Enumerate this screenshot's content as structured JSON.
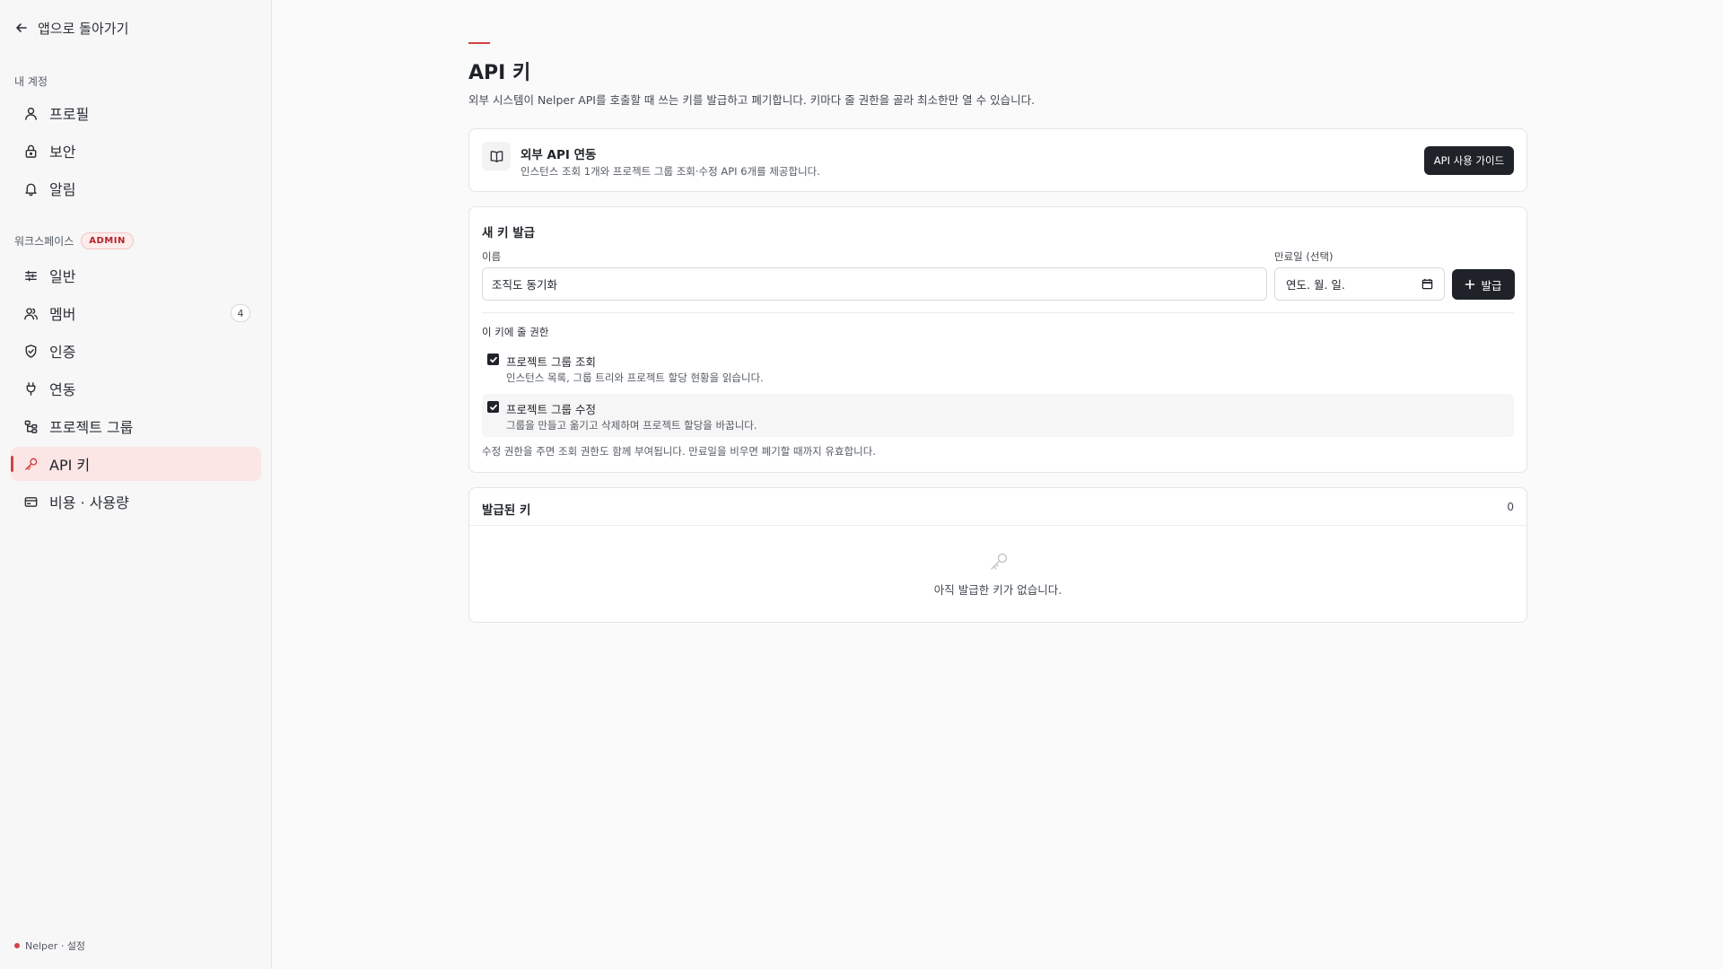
{
  "sidebar": {
    "back_label": "앱으로 돌아가기",
    "account_section_label": "내 계정",
    "account_items": [
      {
        "label": "프로필",
        "icon": "user-icon"
      },
      {
        "label": "보안",
        "icon": "lock-icon"
      },
      {
        "label": "알림",
        "icon": "bell-icon"
      }
    ],
    "workspace_section_label": "워크스페이스",
    "workspace_badge": "ADMIN",
    "workspace_items": [
      {
        "label": "일반",
        "icon": "sliders-icon"
      },
      {
        "label": "멤버",
        "icon": "users-icon",
        "count": "4"
      },
      {
        "label": "인증",
        "icon": "shield-icon"
      },
      {
        "label": "연동",
        "icon": "plug-icon"
      },
      {
        "label": "프로젝트 그룹",
        "icon": "tree-icon"
      },
      {
        "label": "API 키",
        "icon": "key-icon",
        "active": true
      },
      {
        "label": "비용 · 사용량",
        "icon": "card-icon"
      }
    ],
    "footer": "Nelper · 설정"
  },
  "page": {
    "title": "API 키",
    "description": "외부 시스템이 Nelper API를 호출할 때 쓰는 키를 발급하고 폐기합니다. 키마다 줄 권한을 골라 최소한만 열 수 있습니다."
  },
  "guide": {
    "title": "외부 API 연동",
    "description": "인스턴스 조회 1개와 프로젝트 그룹 조회·수정 API 6개를 제공합니다.",
    "button_label": "API 사용 가이드"
  },
  "new_key": {
    "title": "새 키 발급",
    "name_label": "이름",
    "name_value": "조직도 동기화",
    "expiry_label": "만료일 (선택)",
    "expiry_placeholder": "연도. 월. 일.",
    "issue_button": "발급",
    "permissions_label": "이 키에 줄 권한",
    "permissions": [
      {
        "title": "프로젝트 그룹 조회",
        "description": "인스턴스 목록, 그룹 트리와 프로젝트 할당 현황을 읽습니다.",
        "checked": true
      },
      {
        "title": "프로젝트 그룹 수정",
        "description": "그룹을 만들고 옮기고 삭제하며 프로젝트 할당을 바꿉니다.",
        "checked": true
      }
    ],
    "note": "수정 권한을 주면 조회 권한도 함께 부여됩니다. 만료일을 비우면 폐기할 때까지 유효합니다."
  },
  "issued_keys": {
    "title": "발급된 키",
    "count": "0",
    "empty_text": "아직 발급한 키가 없습니다."
  },
  "colors": {
    "accent": "#d14343",
    "dark_button": "#1f2329",
    "active_bg": "#fbe5e5"
  }
}
